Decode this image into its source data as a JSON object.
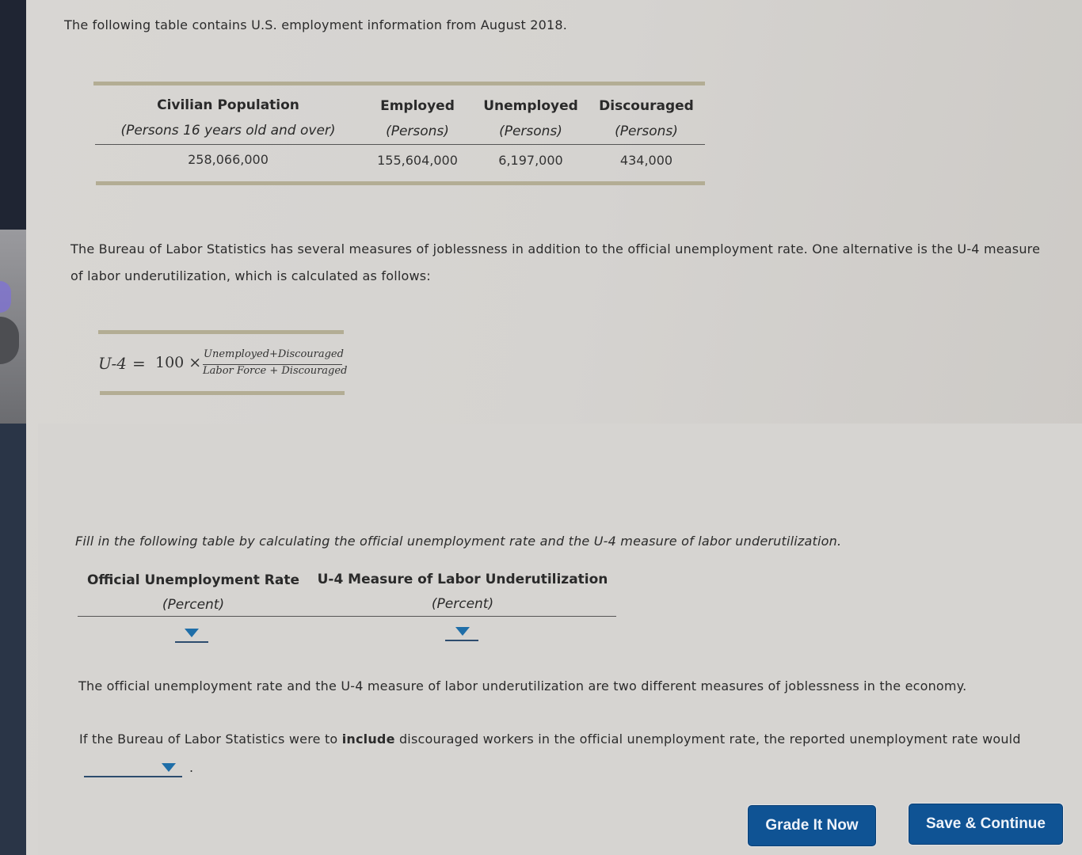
{
  "intro_text": "The following table contains U.S. employment information from August 2018.",
  "employment_table": {
    "columns": [
      {
        "header": "Civilian Population",
        "subheader": "(Persons 16 years old and over)",
        "value": "258,066,000"
      },
      {
        "header": "Employed",
        "subheader": "(Persons)",
        "value": "155,604,000"
      },
      {
        "header": "Unemployed",
        "subheader": "(Persons)",
        "value": "6,197,000"
      },
      {
        "header": "Discouraged",
        "subheader": "(Persons)",
        "value": "434,000"
      }
    ]
  },
  "bls_paragraph": {
    "line1": "The Bureau of Labor Statistics has several measures of joblessness in addition to the official unemployment rate. One alternative is the U-4 measure",
    "line2": "of labor underutilization, which is calculated as follows:"
  },
  "formula": {
    "lhs": "U-4",
    "equals": "=",
    "multiplier": "100 ×",
    "numerator": "Unemployed+Discouraged",
    "denominator": "Labor Force + Discouraged"
  },
  "fill_instruction": "Fill in the following table by calculating the official unemployment rate and the U-4 measure of labor underutilization.",
  "answer_table": {
    "columns": [
      {
        "header": "Official Unemployment Rate",
        "subheader": "(Percent)",
        "selected": ""
      },
      {
        "header": "U-4 Measure of Labor Underutilization",
        "subheader": "(Percent)",
        "selected": ""
      }
    ]
  },
  "statement_text": "The official unemployment rate and the U-4 measure of labor underutilization are two different measures of joblessness in the economy.",
  "question": {
    "prefix": "If the Bureau of Labor Statistics were to ",
    "bold": "include",
    "suffix": " discouraged workers in the official unemployment rate, the reported unemployment rate would",
    "selected": "",
    "end_punct": "."
  },
  "buttons": {
    "grade": "Grade It Now",
    "save": "Save & Continue"
  },
  "colors": {
    "button_bg": "#0f5394",
    "dropdown_arrow": "#1f6ea8",
    "table_rule": "#b3ad94"
  }
}
